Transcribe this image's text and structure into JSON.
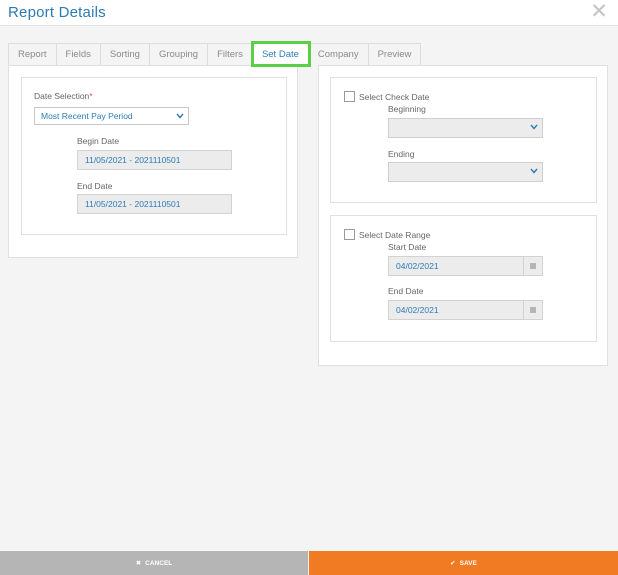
{
  "header": {
    "title": "Report Details",
    "close_icon": "close-icon"
  },
  "tabs": [
    {
      "label": "Report"
    },
    {
      "label": "Fields"
    },
    {
      "label": "Sorting"
    },
    {
      "label": "Grouping"
    },
    {
      "label": "Filters"
    },
    {
      "label": "Set Date",
      "active": true
    },
    {
      "label": "Company"
    },
    {
      "label": "Preview"
    }
  ],
  "left": {
    "date_selection_label": "Date Selection",
    "required_mark": "*",
    "date_selection_value": "Most Recent Pay Period",
    "begin_date_label": "Begin Date",
    "begin_date_value": "11/05/2021 - 2021110501",
    "end_date_label": "End Date",
    "end_date_value": "11/05/2021 - 2021110501"
  },
  "right": {
    "check_date": {
      "checkbox_label": "Select Check Date",
      "beginning_label": "Beginning",
      "beginning_value": "",
      "ending_label": "Ending",
      "ending_value": ""
    },
    "date_range": {
      "checkbox_label": "Select Date Range",
      "start_label": "Start Date",
      "start_value": "04/02/2021",
      "end_label": "End Date",
      "end_value": "04/02/2021"
    }
  },
  "footer": {
    "cancel_label": "CANCEL",
    "save_label": "SAVE"
  },
  "colors": {
    "accent": "#2c7bb5",
    "save": "#f07b22",
    "cancel": "#b5b5b5",
    "active_tab_outline": "#5ad044"
  }
}
